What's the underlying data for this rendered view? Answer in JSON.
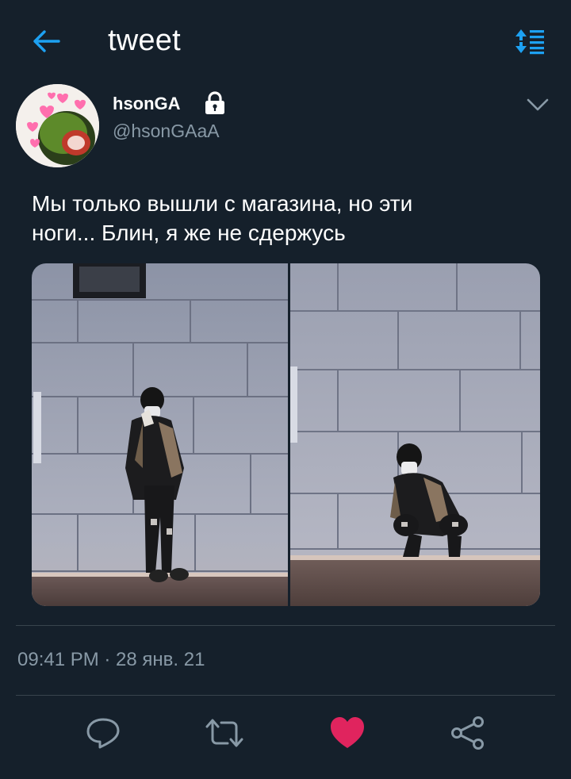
{
  "header": {
    "title": "tweet",
    "back_icon": "arrow-left-icon",
    "sort_icon": "sort-toggle-icon"
  },
  "author": {
    "display_name": "hsonGA",
    "handle": "@hsonGAaA",
    "protected_icon": "lock-icon",
    "avatar_icon": "avatar-image"
  },
  "tweet": {
    "text_line1": "Мы только вышли с магазина, но эти",
    "text_line2": "ноги... Блин, я же не сдержусь",
    "timestamp": "09:41 PM · 28 янв. 21"
  },
  "media": [
    {
      "icon": "photo-standing"
    },
    {
      "icon": "photo-squatting"
    }
  ],
  "actions": [
    {
      "icon": "reply-icon"
    },
    {
      "icon": "retweet-icon"
    },
    {
      "icon": "like-icon",
      "active": true
    },
    {
      "icon": "share-icon"
    }
  ],
  "colors": {
    "background": "#15202b",
    "accent": "#1da1f2",
    "secondary_text": "#8899a6",
    "like": "#e0245e",
    "divider": "#38444d"
  }
}
